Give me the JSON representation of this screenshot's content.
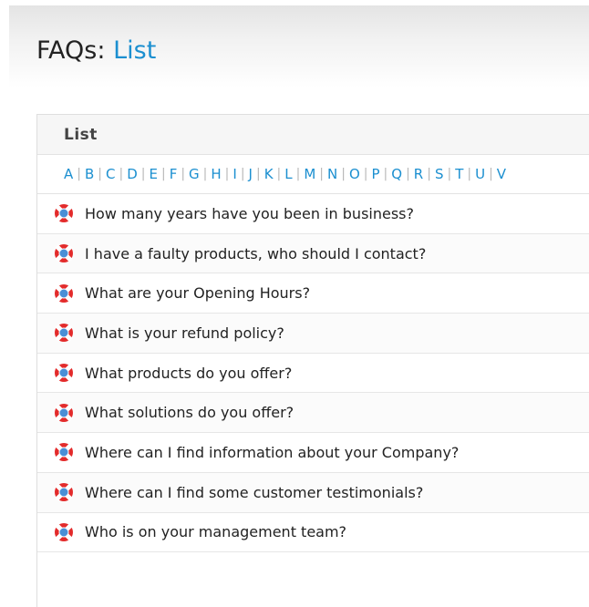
{
  "page": {
    "title": "FAQs",
    "separator": ":",
    "breadcrumb": "List"
  },
  "panel": {
    "header": "List"
  },
  "alphabet": [
    "A",
    "B",
    "C",
    "D",
    "E",
    "F",
    "G",
    "H",
    "I",
    "J",
    "K",
    "L",
    "M",
    "N",
    "O",
    "P",
    "Q",
    "R",
    "S",
    "T",
    "U",
    "V"
  ],
  "faqs": [
    "How many years have you been in business?",
    "I have a faulty products, who should I contact?",
    "What are your Opening Hours?",
    "What is your refund policy?",
    "What products do you offer?",
    "What solutions do you offer?",
    "Where can I find information about your Company?",
    "Where can I find some customer testimonials?",
    "Who is on your management team?"
  ],
  "icon": {
    "name": "lifebuoy-icon",
    "ring_color": "#e32b2b",
    "band_color": "#ffffff",
    "center_color": "#4a8fd6"
  },
  "colors": {
    "link": "#1b8fd0",
    "text": "#222222"
  }
}
